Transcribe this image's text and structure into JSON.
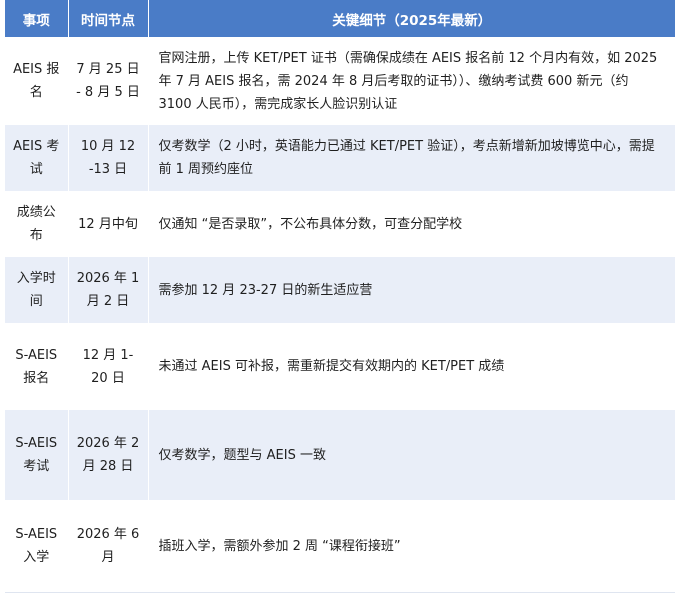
{
  "table": {
    "headers": [
      "事项",
      "时间节点",
      "关键细节（2025年最新）"
    ],
    "rows": [
      {
        "item": "AEIS 报名",
        "time": "7 月 25 日 - 8 月 5 日",
        "detail": "官网注册，上传 KET/PET 证书（需确保成绩在 AEIS 报名前 12 个月内有效，如 2025 年 7 月 AEIS 报名，需 2024 年 8 月后考取的证书））、缴纳考试费 600 新元（约 3100 人民币），需完成家长人脸识别认证"
      },
      {
        "item": "AEIS 考试",
        "time": "10 月 12 -13 日",
        "detail": "仅考数学（2 小时，英语能力已通过 KET/PET 验证），考点新增新加坡博览中心，需提前 1 周预约座位"
      },
      {
        "item": "成绩公布",
        "time": "12 月中旬",
        "detail": "仅通知 “是否录取”，不公布具体分数，可查分配学校"
      },
      {
        "item": "入学时间",
        "time": "2026 年 1 月 2 日",
        "detail": "需参加 12 月 23-27 日的新生适应营"
      },
      {
        "item": "S-AEIS 报名",
        "time": "12 月 1-20 日",
        "detail": "未通过 AEIS 可补报，需重新提交有效期内的 KET/PET 成绩"
      },
      {
        "item": "S-AEIS 考试",
        "time": "2026 年 2 月 28 日",
        "detail": "仅考数学，题型与 AEIS 一致"
      },
      {
        "item": "S-AEIS 入学",
        "time": "2026 年 6 月",
        "detail": "插班入学，需额外参加 2 周 “课程衔接班”"
      }
    ]
  }
}
